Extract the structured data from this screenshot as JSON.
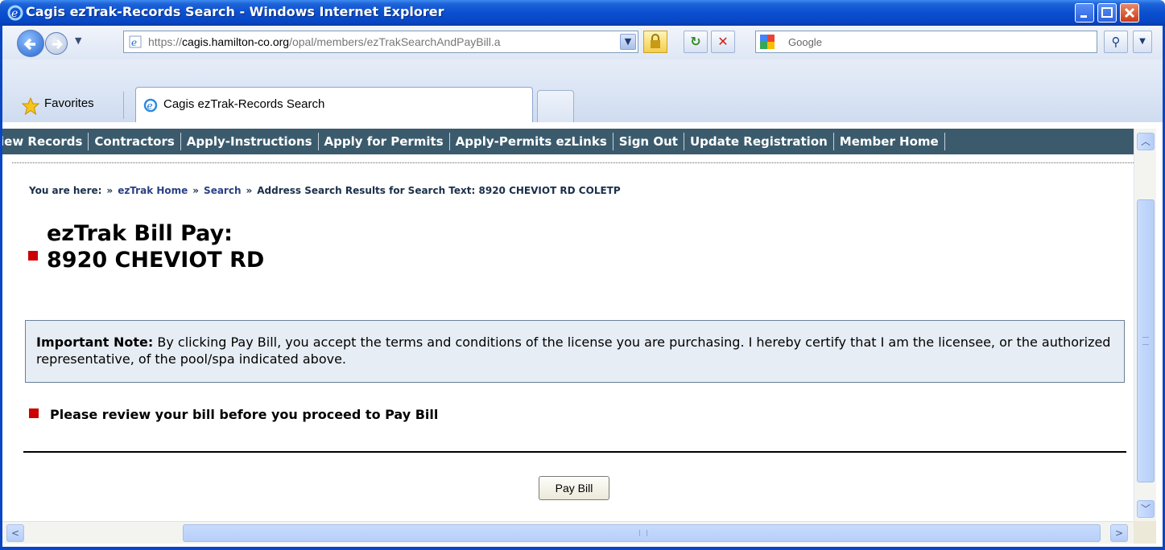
{
  "window": {
    "title": "Cagis ezTrak-Records Search - Windows Internet Explorer"
  },
  "toolbar": {
    "address_scheme": "https://",
    "address_domain": "cagis.hamilton-co.org",
    "address_path": "/opal/members/ezTrakSearchAndPayBill.a",
    "search_placeholder": "Google",
    "favorites_label": "Favorites"
  },
  "tabs": [
    {
      "label": "Cagis ezTrak-Records Search"
    }
  ],
  "site_nav": {
    "items": [
      {
        "label": "iew Records"
      },
      {
        "label": "Contractors"
      },
      {
        "label": "Apply-Instructions"
      },
      {
        "label": "Apply for Permits"
      },
      {
        "label": "Apply-Permits ezLinks"
      },
      {
        "label": "Sign Out"
      },
      {
        "label": "Update Registration"
      },
      {
        "label": "Member Home"
      }
    ]
  },
  "breadcrumb": {
    "prefix": "You are here:",
    "sep": "»",
    "home": "ezTrak Home",
    "search": "Search",
    "current": "Address Search Results for Search Text: 8920 CHEVIOT RD COLETP"
  },
  "heading": {
    "line1": "ezTrak Bill Pay:",
    "line2": "8920 CHEVIOT RD"
  },
  "note": {
    "label": "Important Note:",
    "text": " By clicking Pay Bill, you accept the terms and conditions of the license you are purchasing. I hereby certify that I am the licensee, or the authorized representative, of the pool/spa indicated above."
  },
  "review_text": "Please review your bill before you proceed to Pay Bill",
  "pay_button_label": "Pay Bill",
  "colors": {
    "titlebar": "#0a4fd0",
    "site_nav_bg": "#3b5b6d",
    "bullet": "#cc0000",
    "note_bg": "#e7edf4"
  }
}
